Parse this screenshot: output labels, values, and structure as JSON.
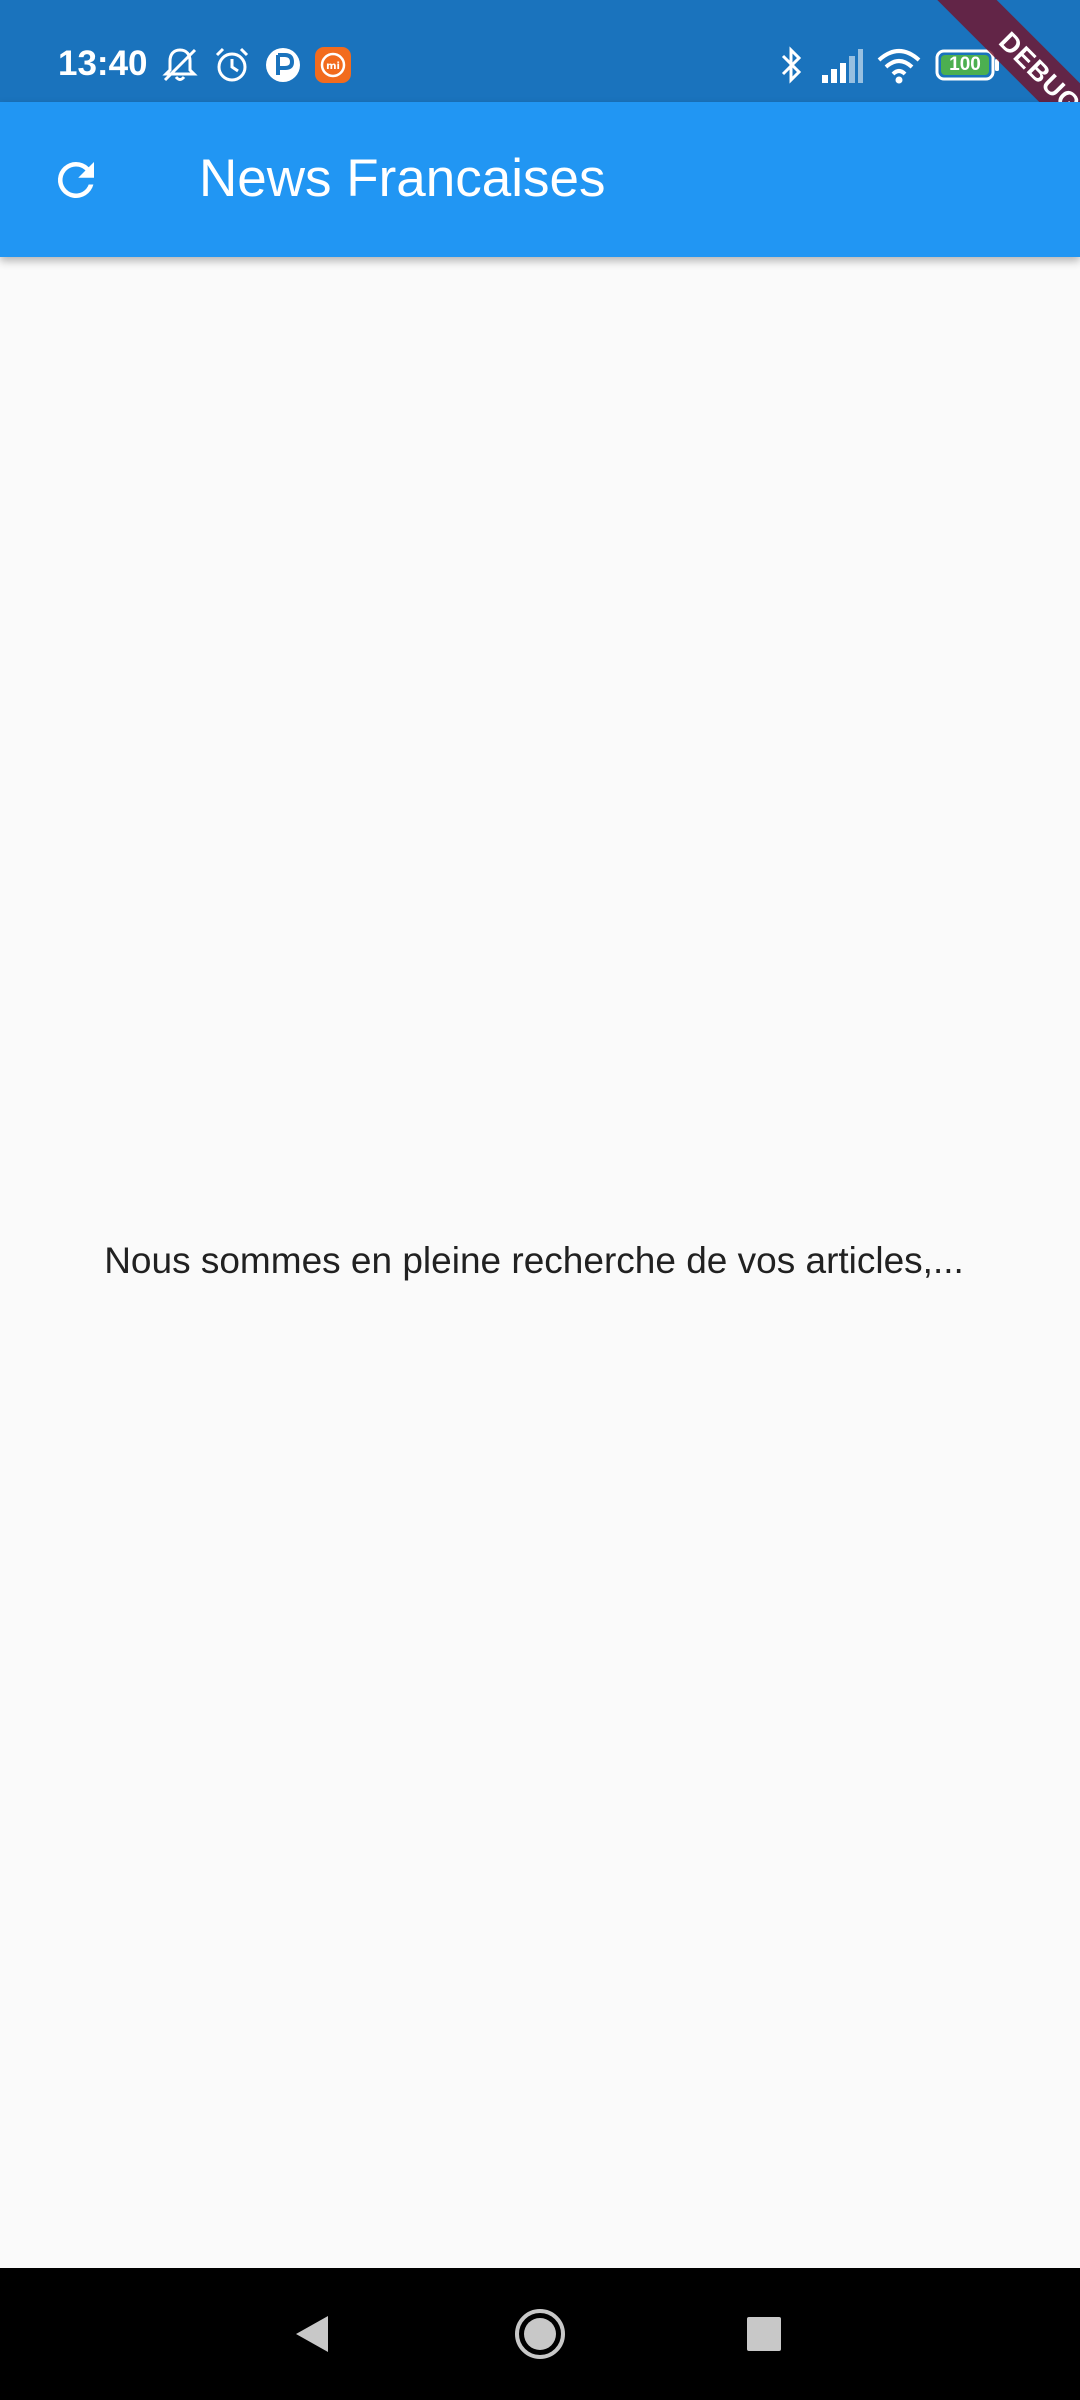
{
  "status_bar": {
    "time": "13:40",
    "battery": "100",
    "left_icons": [
      "bell-off-icon",
      "alarm-icon",
      "app-p-icon",
      "mi-app-icon"
    ],
    "right_icons": [
      "bluetooth-icon",
      "signal-icon",
      "wifi-icon",
      "battery-icon"
    ]
  },
  "debug_banner": {
    "label": "DEBUG"
  },
  "app_bar": {
    "title": "News Francaises",
    "leading_icon": "refresh-icon"
  },
  "body": {
    "message": "Nous sommes en pleine recherche de vos articles,..."
  },
  "navigation_bar": {
    "buttons": [
      "back-icon",
      "home-icon",
      "recents-icon"
    ]
  },
  "colors": {
    "status_bar": "#1a73bd",
    "app_bar": "#2196f3",
    "background": "#fafafa",
    "text": "#212121",
    "debug_banner": "#73142d",
    "battery_fill": "#4caf50"
  }
}
